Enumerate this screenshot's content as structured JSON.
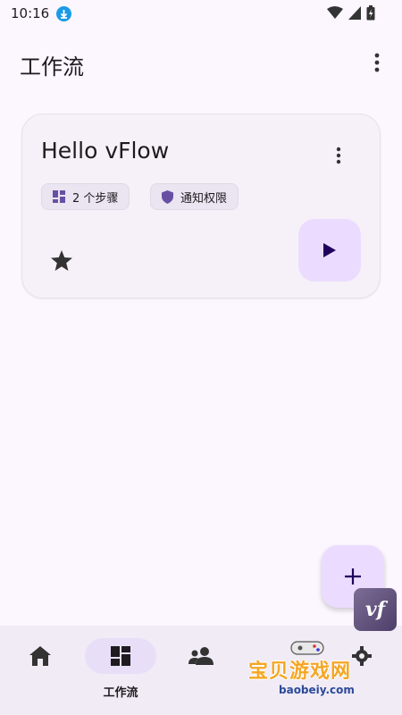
{
  "status_bar": {
    "time": "10:16"
  },
  "app_bar": {
    "title": "工作流"
  },
  "workflow_card": {
    "title": "Hello vFlow",
    "chips": {
      "steps": "2 个步骤",
      "permission": "通知权限"
    },
    "favorite": true
  },
  "bottom_nav": {
    "items": [
      {
        "id": "home",
        "label": ""
      },
      {
        "id": "workflows",
        "label": "工作流",
        "active": true
      },
      {
        "id": "modules",
        "label": ""
      },
      {
        "id": "settings",
        "label": ""
      }
    ]
  },
  "badge": {
    "text": "vf"
  },
  "watermark": {
    "text": "宝贝游戏网",
    "url": "baobeiy.com"
  },
  "colors": {
    "background": "#fcf6ff",
    "card": "#f6f1f8",
    "primary_container": "#ebdcff",
    "nav_active": "#e8def8",
    "icon_purple": "#6750a4"
  }
}
